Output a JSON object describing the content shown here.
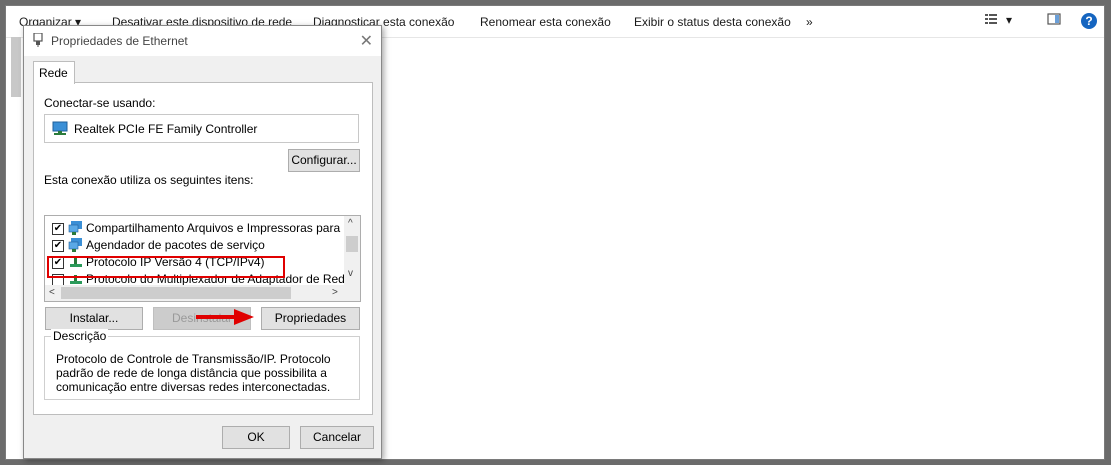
{
  "toolbar": {
    "items": [
      "Organizar ▾",
      "Desativar este dispositivo de rede",
      "Diagnosticar esta conexão",
      "Renomear esta conexão",
      "Exibir o status desta conexão",
      "»"
    ],
    "view_arrow": "▾",
    "help": "?"
  },
  "dialog": {
    "title": "Propriedades de Ethernet",
    "close": "✕",
    "tab_label": "Rede",
    "connect_using_label": "Conectar-se usando:",
    "adapter_name": "Realtek PCIe FE Family Controller",
    "configure_button": "Configurar...",
    "items_label": "Esta conexão utiliza os seguintes itens:",
    "items": [
      {
        "label": "Compartilhamento Arquivos e Impressoras para Redes",
        "checked": true,
        "icon": "network-share-icon"
      },
      {
        "label": "Agendador de pacotes de serviço",
        "checked": true,
        "icon": "network-share-icon"
      },
      {
        "label": "Protocolo IP Versão 4 (TCP/IPv4)",
        "checked": true,
        "icon": "protocol-icon"
      },
      {
        "label": "Protocolo do Multiplexador de Adaptador de Rede da M",
        "checked": false,
        "icon": "protocol-icon"
      }
    ],
    "check_mark": "✔",
    "scroll_up": "^",
    "scroll_down": "v",
    "scroll_left": "<",
    "scroll_right": ">",
    "install_button": "Instalar...",
    "uninstall_button": "Desinstalar",
    "properties_button": "Propriedades",
    "description_label": "Descrição",
    "description_text": "Protocolo de Controle de Transmissão/IP. Protocolo padrão de rede de longa distância que possibilita a comunicação entre diversas redes interconectadas.",
    "ok_button": "OK",
    "cancel_button": "Cancelar"
  },
  "colors": {
    "highlight": "#e00000",
    "help_blue": "#1565c0"
  }
}
